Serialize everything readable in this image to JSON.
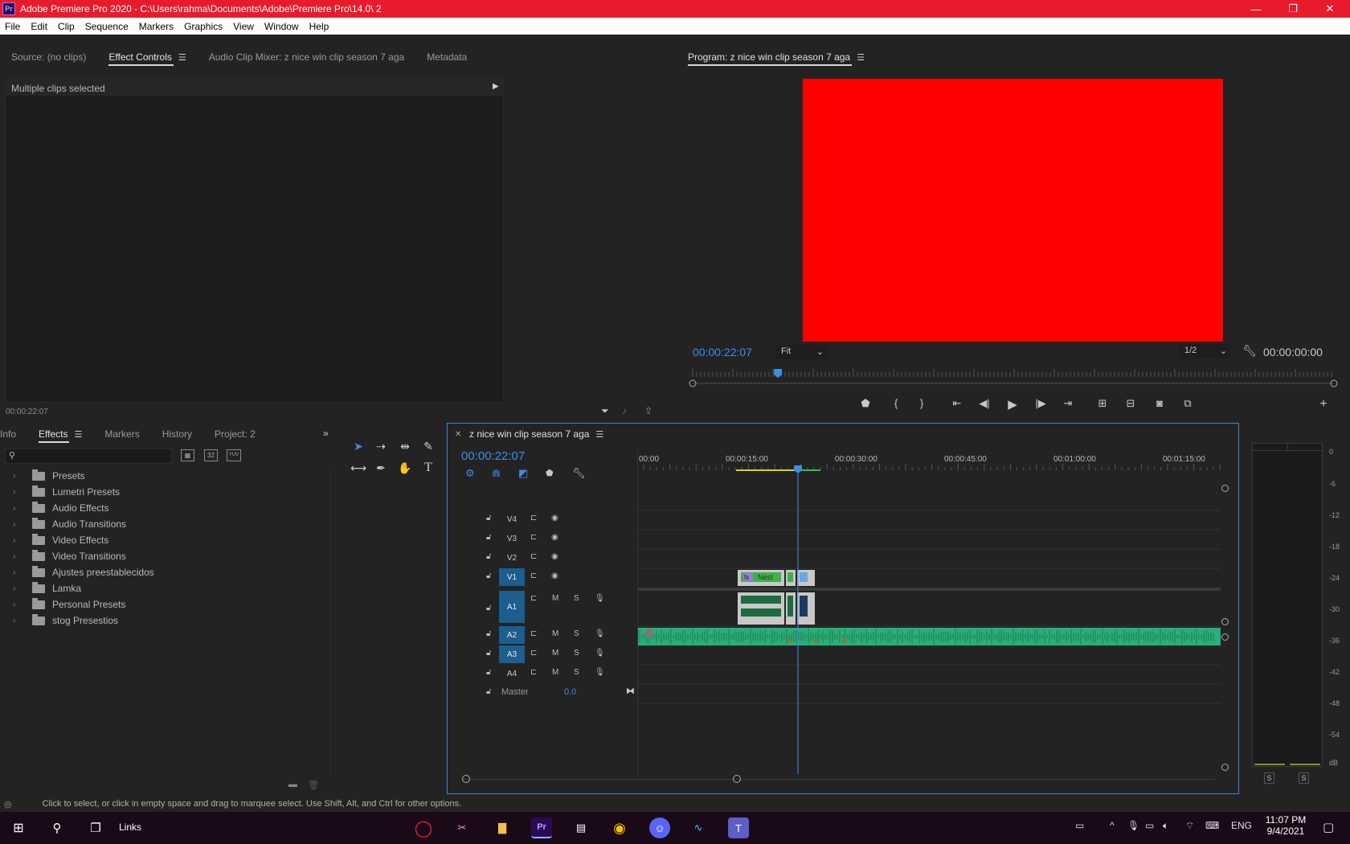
{
  "window": {
    "title": "Adobe Premiere Pro 2020 - C:\\Users\\rahma\\Documents\\Adobe\\Premiere Pro\\14.0\\ 2",
    "logo": "Pr",
    "minimize": "—",
    "restore": "❐",
    "close": "✕"
  },
  "menu": [
    "File",
    "Edit",
    "Clip",
    "Sequence",
    "Markers",
    "Graphics",
    "View",
    "Window",
    "Help"
  ],
  "source_panel": {
    "tabs": [
      "Source: (no clips)",
      "Effect Controls",
      "Audio Clip Mixer: z nice win clip season 7 aga",
      "Metadata"
    ],
    "active_tab": "Effect Controls",
    "header": "Multiple clips selected",
    "timecode": "00:00:22:07"
  },
  "program": {
    "title": "Program: z nice win clip season 7 aga",
    "timecode": "00:00:22:07",
    "fit": "Fit",
    "resolution": "1/2",
    "duration": "00:00:00:00",
    "frame_color": "#fe0000",
    "playhead_fraction": 0.133
  },
  "bottom_left": {
    "tabs": [
      "Info",
      "Effects",
      "Markers",
      "History",
      "Project: 2"
    ],
    "active_tab": "Effects",
    "search_placeholder": "",
    "tree": [
      "Presets",
      "Lumetri Presets",
      "Audio Effects",
      "Audio Transitions",
      "Video Effects",
      "Video Transitions",
      "Ajustes preestablecidos",
      "Lamka",
      "Personal Presets",
      "stog Presestios"
    ],
    "badge_32": "32",
    "badge_yuv": "YUV"
  },
  "timeline": {
    "sequence_name": "z nice win clip season 7 aga",
    "timecode": "00:00:22:07",
    "ruler": [
      "00:00",
      "00:00:15:00",
      "00:00:30:00",
      "00:00:45:00",
      "00:01:00:00",
      "00:01:15:00"
    ],
    "tracks_video": [
      "V4",
      "V3",
      "V2",
      "V1"
    ],
    "tracks_audio": [
      "A1",
      "A2",
      "A3",
      "A4"
    ],
    "m": "M",
    "s": "S",
    "master_label": "Master",
    "master_value": "0.0",
    "nest_label": "Nest",
    "fx": "fx"
  },
  "meter": {
    "scale": [
      "0",
      "-6",
      "-12",
      "-18",
      "-24",
      "-30",
      "-36",
      "-42",
      "-48",
      "-54",
      "dB"
    ],
    "s_buttons": [
      "S",
      "S"
    ]
  },
  "status": "Click to select, or click in empty space and drag to marquee select. Use Shift, Alt, and Ctrl for other options.",
  "taskbar": {
    "links": "Links",
    "lang": "ENG",
    "time": "11:07 PM",
    "date": "9/4/2021"
  }
}
